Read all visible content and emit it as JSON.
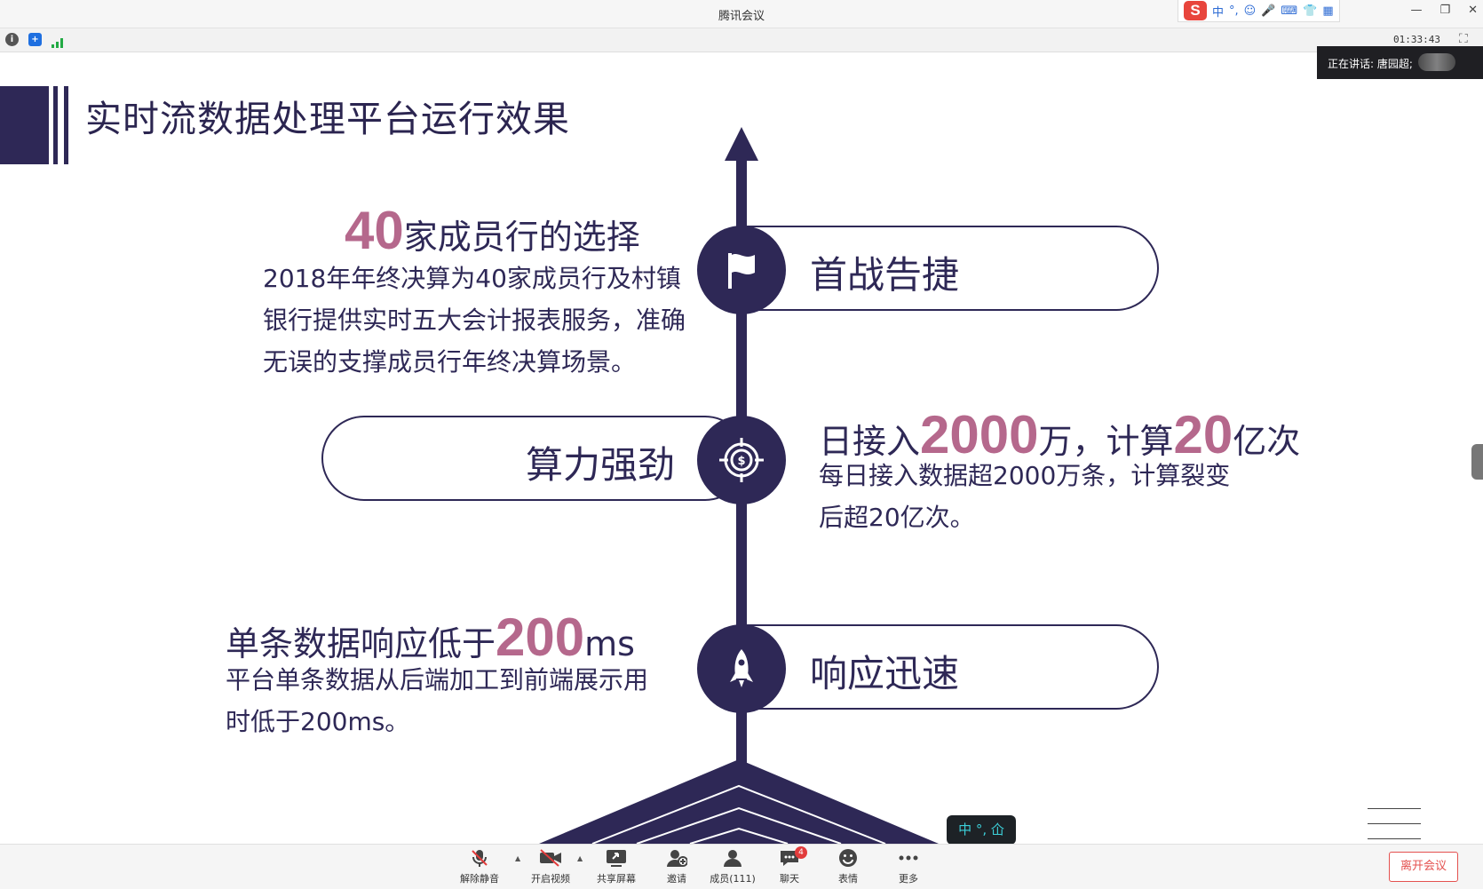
{
  "window": {
    "title": "腾讯会议"
  },
  "ime_bar": {
    "logo": "S",
    "mode": "中",
    "punct": "°,",
    "emoji": "☺",
    "mic": "🎤",
    "kbd": "⌨",
    "skin": "👕",
    "grid": "▦"
  },
  "window_controls": {
    "minimize": "—",
    "restore": "❐",
    "close": "✕"
  },
  "status": {
    "timer": "01:33:43",
    "speaking_label": "正在讲话: 唐园超;"
  },
  "slide": {
    "title": "实时流数据处理平台运行效果",
    "items": [
      {
        "pill_label": "首战告捷",
        "headline_num": "40",
        "headline_text": "家成员行的选择",
        "desc": "2018年年终决算为40家成员行及村镇银行提供实时五大会计报表服务，准确无误的支撑成员行年终决算场景。"
      },
      {
        "pill_label": "算力强劲",
        "headline_pre": "日接入",
        "headline_num1": "2000",
        "headline_mid": "万，计算",
        "headline_num2": "20",
        "headline_post": "亿次",
        "desc": "每日接入数据超2000万条，计算裂变后超20亿次。"
      },
      {
        "pill_label": "响应迅速",
        "headline_pre": "单条数据响应低于",
        "headline_num": "200",
        "headline_post": "ms",
        "desc": "平台单条数据从后端加工到前端展示用时低于200ms。"
      }
    ]
  },
  "ime_float": {
    "text": "中 °, 仚"
  },
  "bottom_toolbar": {
    "unmute": "解除静音",
    "video": "开启视频",
    "share": "共享屏幕",
    "invite": "邀请",
    "members": "成员(111)",
    "chat": "聊天",
    "chat_badge": "4",
    "reactions": "表情",
    "more": "更多",
    "leave": "离开会议"
  },
  "colors": {
    "primary": "#2e2856",
    "accent": "#b5688c",
    "leave": "#e4514f"
  }
}
